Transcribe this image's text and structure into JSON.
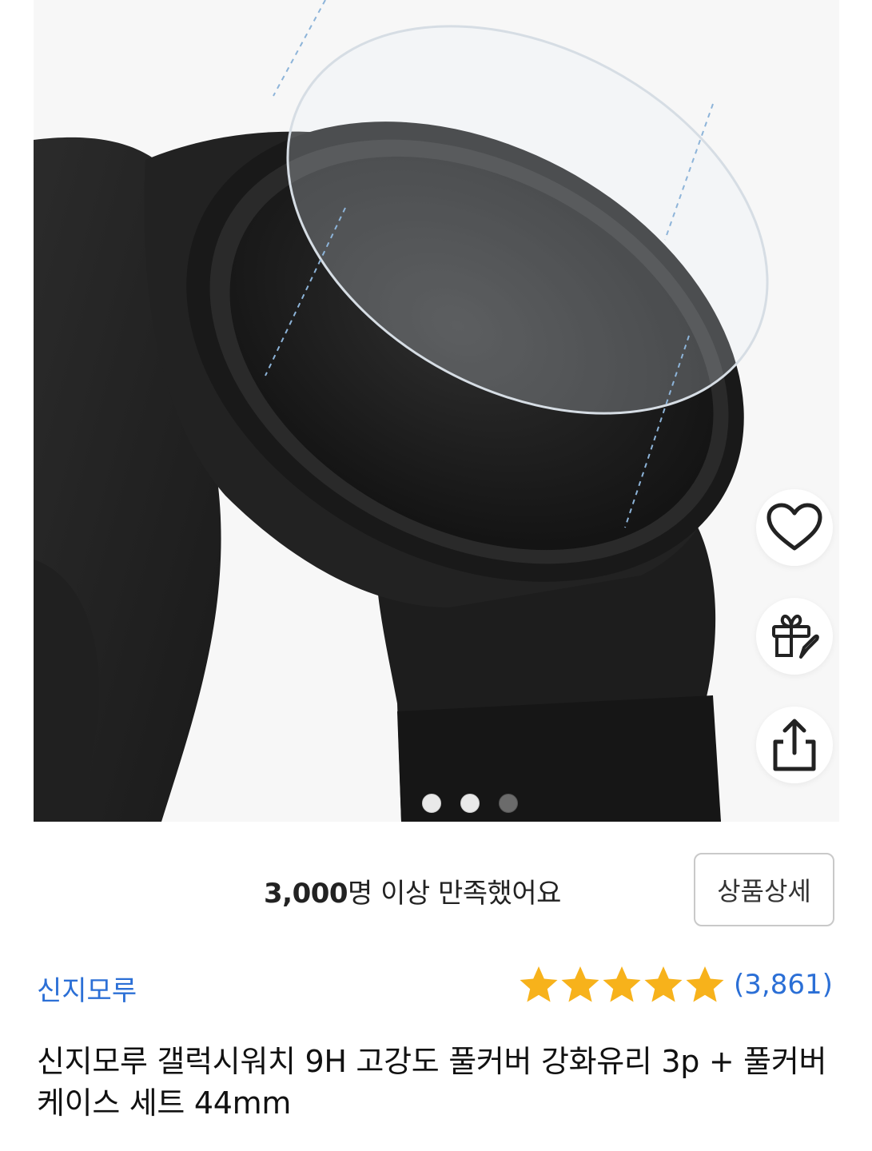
{
  "gallery": {
    "dot_count": 3,
    "active_index": 2
  },
  "actions": {
    "wishlist_icon": "heart-icon",
    "gift_icon": "gift-rocket-icon",
    "share_icon": "share-icon"
  },
  "satisfaction": {
    "count": "3,000",
    "text": "명 이상 만족했어요",
    "detail_button": "상품상세"
  },
  "product": {
    "brand": "신지모루",
    "rating": 5,
    "review_count": "(3,861)",
    "title": "신지모루 갤럭시워치 9H 고강도 풀커버 강화유리 3p + 풀커버 케이스 세트 44mm"
  },
  "colors": {
    "link_blue": "#2b6fd6",
    "star_gold": "#f7b21b"
  }
}
